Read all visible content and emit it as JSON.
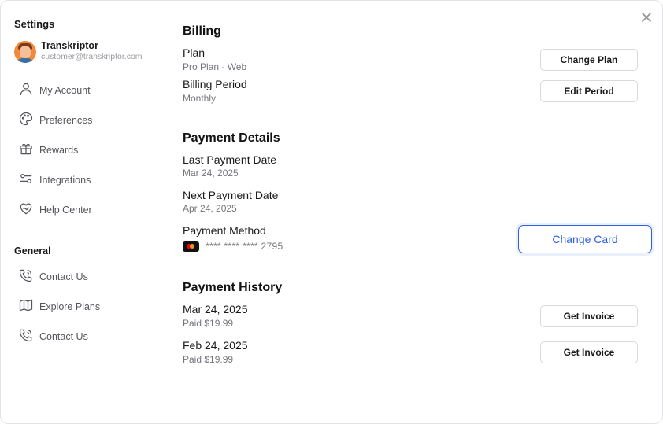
{
  "sidebar": {
    "title": "Settings",
    "profile": {
      "name": "Transkriptor",
      "email": "customer@transkriptor.com"
    },
    "items": [
      {
        "label": "My Account",
        "icon": "user-icon"
      },
      {
        "label": "Preferences",
        "icon": "palette-icon"
      },
      {
        "label": "Rewards",
        "icon": "gift-icon"
      },
      {
        "label": "Integrations",
        "icon": "sliders-icon"
      },
      {
        "label": "Help Center",
        "icon": "heart-hand-icon"
      }
    ],
    "general_title": "General",
    "general_items": [
      {
        "label": "Contact Us",
        "icon": "phone-icon"
      },
      {
        "label": "Explore Plans",
        "icon": "map-icon"
      },
      {
        "label": "Contact Us",
        "icon": "phone-icon"
      }
    ]
  },
  "billing": {
    "title": "Billing",
    "plan_label": "Plan",
    "plan_value": "Pro Plan - Web",
    "change_plan_button": "Change Plan",
    "period_label": "Billing Period",
    "period_value": "Monthly",
    "edit_period_button": "Edit Period"
  },
  "payment": {
    "title": "Payment Details",
    "last_label": "Last Payment Date",
    "last_value": "Mar 24, 2025",
    "next_label": "Next Payment Date",
    "next_value": "Apr 24, 2025",
    "method_label": "Payment Method",
    "card_number": "**** **** **** 2795",
    "card_brand": "mastercard",
    "change_card_button": "Change Card"
  },
  "history": {
    "title": "Payment History",
    "entries": [
      {
        "date": "Mar 24, 2025",
        "amount": "Paid $19.99",
        "button": "Get Invoice"
      },
      {
        "date": "Feb 24, 2025",
        "amount": "Paid $19.99",
        "button": "Get Invoice"
      }
    ]
  },
  "colors": {
    "accent": "#2f5fe3",
    "text_muted": "#75757c",
    "border": "#d9d9de"
  }
}
